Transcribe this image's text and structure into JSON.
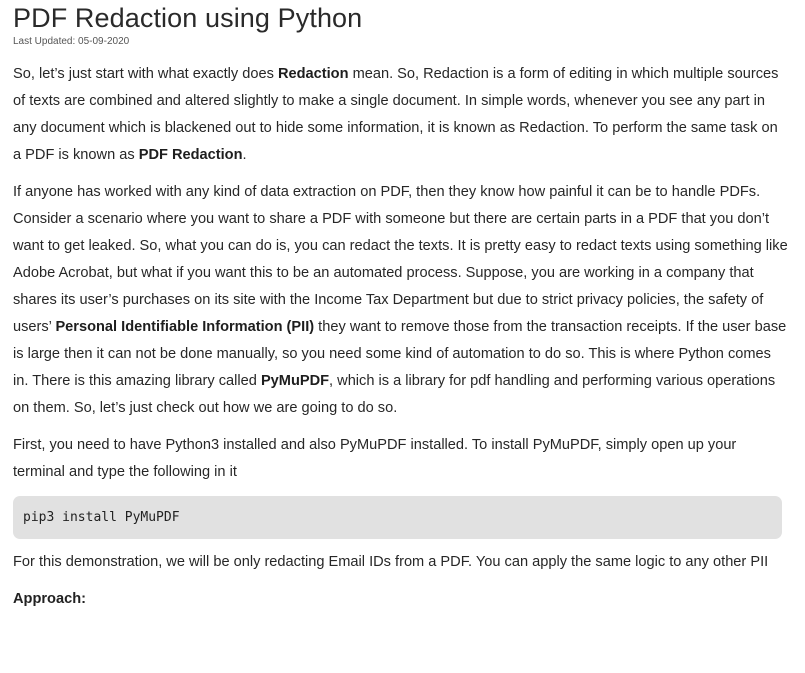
{
  "article": {
    "title": "PDF Redaction using Python",
    "last_updated": "Last Updated: 05-09-2020",
    "p1": {
      "t1": "So, let’s just start with what exactly does ",
      "b1": "Redaction",
      "t2": " mean. So, Redaction is a form of editing in which multiple sources of texts are combined and altered slightly to make a single document. In simple words, whenever you see any part in any document which is blackened out to hide some information, it is known as Redaction. To perform the same task on a PDF is known as ",
      "b2": "PDF Redaction",
      "t3": "."
    },
    "p2": {
      "t1": "If anyone has worked with any kind of data extraction on PDF, then they know how painful it can be to handle PDFs. Consider a scenario where you want to share a PDF with someone but there are certain parts in a PDF that you don’t want to get leaked. So, what you can do is, you can redact the texts. It is pretty easy to redact texts using something like Adobe Acrobat, but what if you want this to be an automated process. Suppose, you are working in a company that shares its user’s purchases on its site with the Income Tax Department but due to strict privacy policies, the safety of users’ ",
      "b1": "Personal Identifiable Information (PII)",
      "t2": " they want to remove those from the transaction receipts. If the user base is large then it can not be done manually, so you need some kind of automation to do so. This is where Python comes in. There is this amazing library called ",
      "b2": "PyMuPDF",
      "t3": ", which is a library for pdf handling and performing various operations on them. So, let’s just check out how we are going to do so."
    },
    "p3": "First, you need to have Python3 installed and also PyMuPDF installed. To install PyMuPDF, simply open up your terminal and type the following in it",
    "code": "pip3 install PyMuPDF",
    "p4": "For this demonstration, we will be only redacting Email IDs from a PDF. You can apply the same logic to any other PII",
    "approach_heading": "Approach:"
  }
}
